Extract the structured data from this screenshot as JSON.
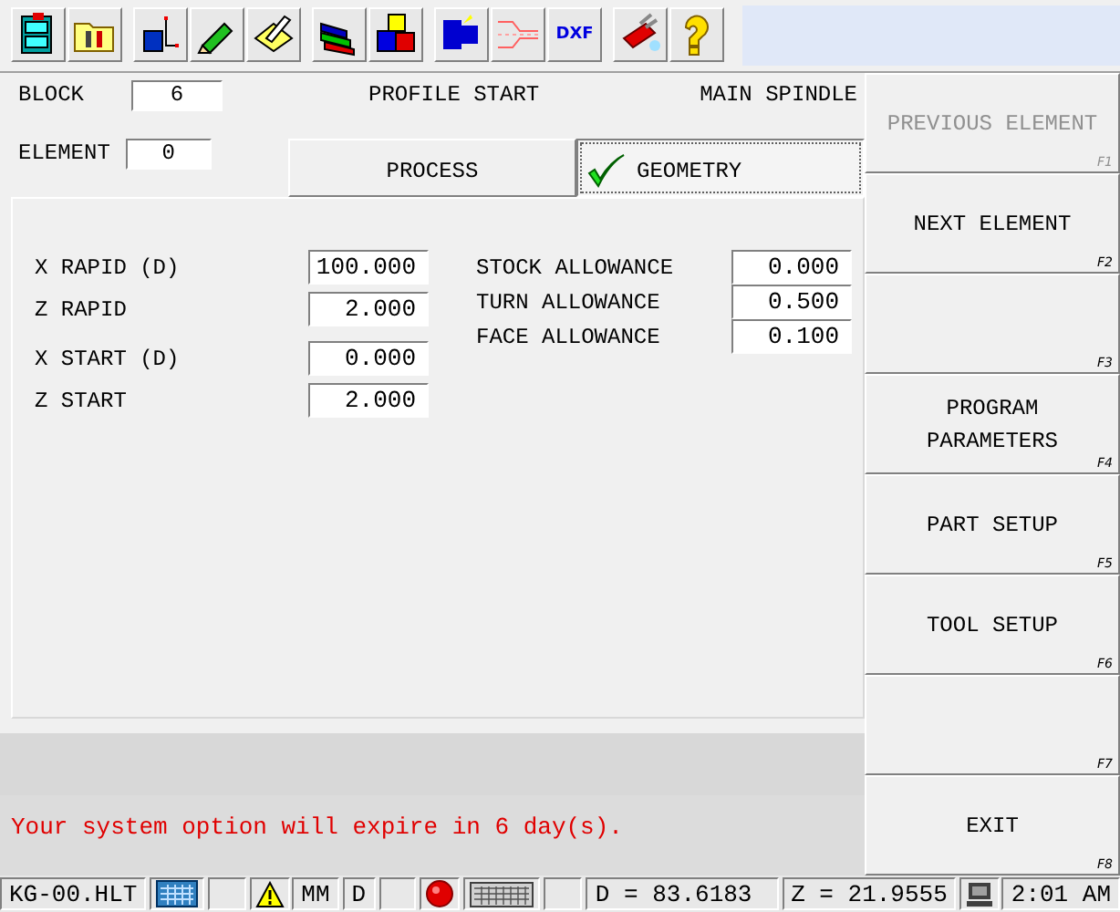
{
  "toolbar": [
    {
      "items": [
        {
          "kind": "cabinet"
        },
        {
          "kind": "folder"
        }
      ]
    },
    {
      "items": [
        {
          "kind": "spindle"
        },
        {
          "kind": "pencil"
        },
        {
          "kind": "note"
        }
      ]
    },
    {
      "items": [
        {
          "kind": "markers"
        },
        {
          "kind": "blocks"
        }
      ]
    },
    {
      "items": [
        {
          "kind": "tool"
        },
        {
          "kind": "profile"
        },
        {
          "kind": "dxf",
          "label": "DXF"
        }
      ]
    },
    {
      "items": [
        {
          "kind": "knife"
        },
        {
          "kind": "help"
        }
      ]
    }
  ],
  "header": {
    "block_label": "BLOCK",
    "block_value": "6",
    "title": "PROFILE START",
    "spindle": "MAIN SPINDLE",
    "element_label": "ELEMENT",
    "element_value": "0"
  },
  "tabs": [
    {
      "label": "PROCESS",
      "selected": false
    },
    {
      "label": "GEOMETRY",
      "selected": true
    }
  ],
  "geometry": {
    "left_groups": [
      {
        "fields": [
          {
            "label": "X RAPID (D)",
            "value": "100.000"
          },
          {
            "label": "Z RAPID",
            "value": "2.000"
          }
        ]
      },
      {
        "fields": [
          {
            "label": "X START (D)",
            "value": "0.000"
          },
          {
            "label": "Z START",
            "value": "2.000"
          }
        ]
      }
    ],
    "right_fields": [
      {
        "label": "STOCK ALLOWANCE",
        "value": "0.000"
      },
      {
        "label": "TURN ALLOWANCE",
        "value": "0.500"
      },
      {
        "label": "FACE ALLOWANCE",
        "value": "0.100"
      }
    ]
  },
  "message": "Your system option will expire in 6 day(s).",
  "softkeys": [
    {
      "label": "PREVIOUS ELEMENT",
      "key": "F1",
      "disabled": true
    },
    {
      "label": "NEXT ELEMENT",
      "key": "F2",
      "disabled": false
    },
    {
      "key": "F3",
      "disabled": false
    },
    {
      "label": "PROGRAM PARAMETERS",
      "key": "F4",
      "disabled": false
    },
    {
      "label": "PART SETUP",
      "key": "F5",
      "disabled": false
    },
    {
      "label": "TOOL SETUP",
      "key": "F6",
      "disabled": false
    },
    {
      "key": "F7",
      "disabled": false
    },
    {
      "label": "EXIT",
      "key": "F8",
      "disabled": false
    }
  ],
  "status_bar": [
    {
      "kind": "text",
      "text": "KG-00.HLT"
    },
    {
      "kind": "calculator"
    },
    {
      "kind": "blank"
    },
    {
      "kind": "warning",
      "text": "MM"
    },
    {
      "kind": "text",
      "text": "D"
    },
    {
      "kind": "blank"
    },
    {
      "kind": "record"
    },
    {
      "kind": "keyboard"
    },
    {
      "kind": "blank"
    },
    {
      "kind": "text",
      "text": "D = 83.6183"
    },
    {
      "kind": "text",
      "text": "Z = 21.9555"
    },
    {
      "kind": "computer",
      "text": "2:01 AM"
    }
  ]
}
